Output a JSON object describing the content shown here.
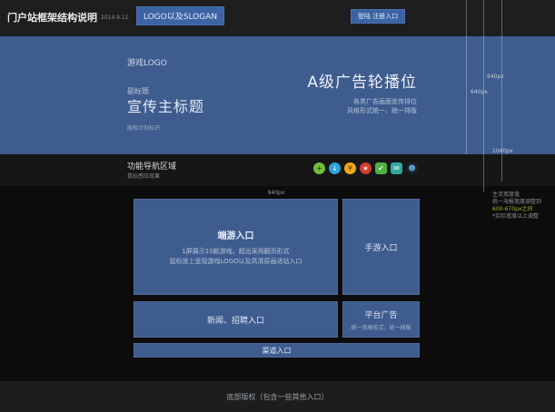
{
  "meta": {
    "title": "门户站框架结构说明",
    "date": "2014.9.11"
  },
  "header": {
    "logo_button": "LOGO以及SLOGAN",
    "login_button": "登陆 注册入口"
  },
  "banner": {
    "game_logo": "游戏LOGO",
    "subtitle": "副标题",
    "main_title": "宣传主标题",
    "note": "版权计划标识",
    "ad_title": "A级广告轮播位",
    "ad_line1": "各类广告画面宣传排位",
    "ad_line2": "风格形式统一，统一排版"
  },
  "nav": {
    "title": "功能导航区域",
    "subtitle": "鼠标感应效果",
    "icons": [
      {
        "name": "plus-icon",
        "glyph": "+",
        "shape": "circle",
        "bg": "#72bd3e",
        "fg": "#17340b"
      },
      {
        "name": "download-icon",
        "glyph": "↓",
        "shape": "circle",
        "bg": "#2ba4dc",
        "fg": "#eaf6fd"
      },
      {
        "name": "coin-icon",
        "glyph": "¥",
        "shape": "circle",
        "bg": "#f2a71b",
        "fg": "#5a3c05"
      },
      {
        "name": "star-icon",
        "glyph": "★",
        "shape": "circle",
        "bg": "#d23b2e",
        "fg": "#ffddd8"
      },
      {
        "name": "shield-icon",
        "glyph": "✔",
        "shape": "square",
        "bg": "#4fb043",
        "fg": "#eafbe8"
      },
      {
        "name": "chat-icon",
        "glyph": "✉",
        "shape": "square",
        "bg": "#2fa8a0",
        "fg": "#eafcfb"
      },
      {
        "name": "user-icon",
        "glyph": "☻",
        "shape": "circle",
        "bg": "#17202c",
        "fg": "#6aaade"
      }
    ]
  },
  "content": {
    "width_label": "940px",
    "client_box": {
      "title": "端游入口",
      "line1": "1屏展示10款游戏，超出采用翻页形式",
      "line2": "鼠标放上呈现游戏LOGO以及高清原画进站入口"
    },
    "mobile_box": {
      "title": "手游入口"
    },
    "news_box": {
      "title": "新闻、招聘入口"
    },
    "platform_box": {
      "title": "平台广告",
      "subtitle": "统一风格形式，统一排版"
    },
    "channel_bar": {
      "title": "渠道入口"
    }
  },
  "guides": {
    "label_940": "940px",
    "label_640": "640px",
    "label_1040": "1040px",
    "annotation": {
      "line1": "主流宽度值",
      "line2": "统一海报宽度调整到",
      "line3": "600-670px之间",
      "line4": "*实际宽度以上调整"
    }
  },
  "footer": {
    "copyright": "底部版权（包含一些其他入口）"
  },
  "colors": {
    "accent_blue": "#3e5c8e",
    "annotation_green": "#9ab033",
    "page_dark": "#0c0c0c"
  }
}
